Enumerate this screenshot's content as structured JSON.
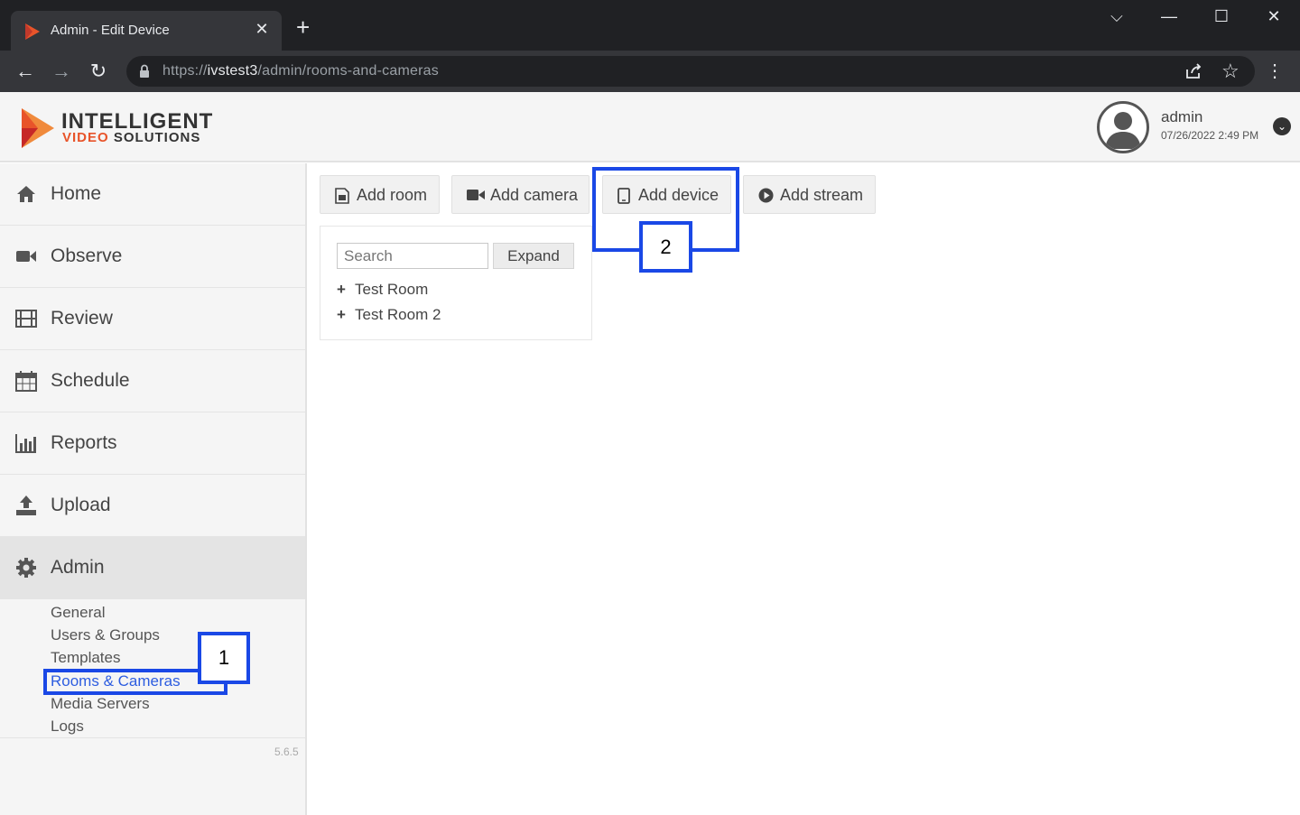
{
  "browser": {
    "tab_title": "Admin - Edit Device",
    "tab_close": "✕",
    "new_tab": "+",
    "url_scheme": "https://",
    "url_host": "ivstest3",
    "url_path": "/admin/rooms-and-cameras"
  },
  "header": {
    "logo_line1": "INTELLIGENT",
    "logo_line2_accent": "VIDEO",
    "logo_line2_rest": " SOLUTIONS",
    "username": "admin",
    "datetime": "07/26/2022 2:49 PM"
  },
  "sidebar": {
    "items": [
      {
        "label": "Home",
        "icon": "home-icon"
      },
      {
        "label": "Observe",
        "icon": "video-camera-icon"
      },
      {
        "label": "Review",
        "icon": "film-icon"
      },
      {
        "label": "Schedule",
        "icon": "calendar-icon"
      },
      {
        "label": "Reports",
        "icon": "bar-chart-icon"
      },
      {
        "label": "Upload",
        "icon": "upload-icon"
      },
      {
        "label": "Admin",
        "icon": "gear-icon"
      }
    ],
    "admin_submenu": [
      "General",
      "Users & Groups",
      "Templates",
      "Rooms & Cameras",
      "Media Servers",
      "Logs"
    ],
    "selected_submenu": "Rooms & Cameras",
    "version": "5.6.5"
  },
  "main": {
    "actions": [
      {
        "label": "Add room",
        "icon": "add-room-icon"
      },
      {
        "label": "Add camera",
        "icon": "video-camera-icon"
      },
      {
        "label": "Add device",
        "icon": "tablet-icon"
      },
      {
        "label": "Add stream",
        "icon": "play-circle-icon"
      }
    ],
    "search_placeholder": "Search",
    "expand_label": "Expand",
    "rooms": [
      "Test Room",
      "Test Room 2"
    ]
  },
  "annotations": [
    "1",
    "2"
  ],
  "colors": {
    "annotation": "#1a48e6",
    "brand_accent": "#e8542a",
    "selected_link": "#2d5de0"
  }
}
